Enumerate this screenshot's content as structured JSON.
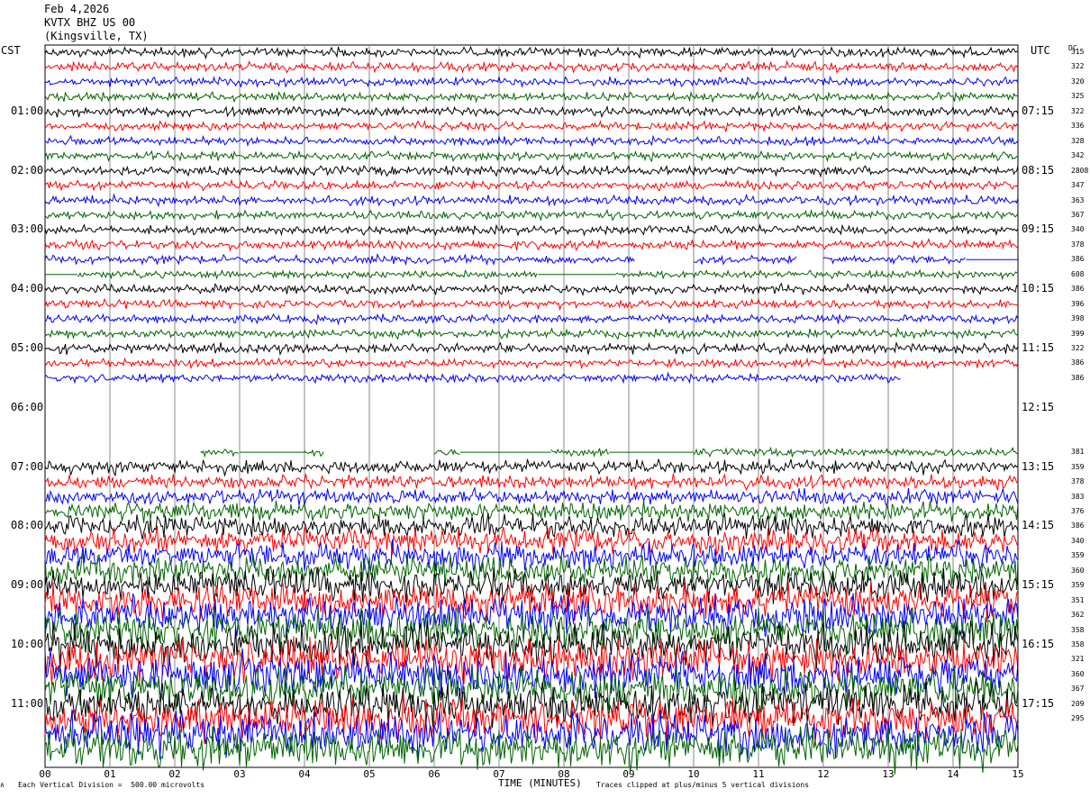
{
  "header": {
    "date": "Feb 4,2026",
    "station": "KVTX BHZ US 00",
    "location": "(Kingsville, TX)"
  },
  "left_zone": "CST",
  "right_zone": "UTC",
  "dc_label": "DC",
  "footer": {
    "vertical_division": "Each Vertical Division =  500.00 microvolts",
    "clipping_note": "Traces clipped at plus/minus 5 vertical divisions",
    "corner_glyph": "∧"
  },
  "chart_data": {
    "type": "line",
    "title": "KVTX BHZ US 00 (Kingsville, TX) Feb 4,2026",
    "xlabel": "TIME (MINUTES)",
    "ylabel": "",
    "xlim": [
      0,
      15
    ],
    "x_ticks": [
      "00",
      "01",
      "02",
      "03",
      "04",
      "05",
      "06",
      "07",
      "08",
      "09",
      "10",
      "11",
      "12",
      "13",
      "14",
      "15"
    ],
    "rows_per_hour": 4,
    "row_minutes": 15,
    "row_count": 48,
    "trace_colors": [
      "#000000",
      "#ff0000",
      "#0000ff",
      "#006400"
    ],
    "hour_labels_left": [
      "01:00",
      "02:00",
      "03:00",
      "04:00",
      "05:00",
      "06:00",
      "07:00",
      "08:00",
      "09:00",
      "10:00",
      "11:00"
    ],
    "hour_labels_right": [
      "07:15",
      "08:15",
      "09:15",
      "10:15",
      "11:15",
      "12:15",
      "13:15",
      "14:15",
      "15:15",
      "16:15",
      "17:15"
    ],
    "dc_offsets": [
      "315",
      "322",
      "320",
      "325",
      "322",
      "336",
      "328",
      "342",
      "2808",
      "347",
      "363",
      "367",
      "340",
      "378",
      "386",
      "608",
      "386",
      "396",
      "398",
      "399",
      "322",
      "386",
      "386",
      "",
      "",
      "",
      "",
      "381",
      "359",
      "378",
      "383",
      "376",
      "386",
      "340",
      "359",
      "360",
      "359",
      "351",
      "362",
      "358",
      "358",
      "321",
      "360",
      "367",
      "209",
      "295"
    ],
    "row_amplitude_divisions": [
      1.1,
      1.1,
      1.0,
      1.0,
      1.1,
      1.0,
      1.0,
      1.0,
      1.1,
      1.1,
      1.1,
      1.0,
      1.0,
      1.1,
      1.0,
      0.9,
      1.1,
      1.0,
      1.0,
      1.0,
      1.2,
      1.0,
      1.0,
      0,
      0,
      0,
      0,
      0.9,
      1.6,
      1.7,
      1.8,
      2.2,
      2.6,
      3.0,
      3.2,
      3.6,
      3.8,
      4.2,
      4.5,
      4.8,
      4.8,
      4.9,
      5.0,
      5.0,
      5.0,
      5.0,
      5.0,
      5.0
    ],
    "data_segments_minutes": [
      [
        [
          0,
          15
        ]
      ],
      [
        [
          0,
          15
        ]
      ],
      [
        [
          0,
          15
        ]
      ],
      [
        [
          0,
          15
        ]
      ],
      [
        [
          0,
          15
        ]
      ],
      [
        [
          0,
          15
        ]
      ],
      [
        [
          0,
          15
        ]
      ],
      [
        [
          0,
          15
        ]
      ],
      [
        [
          0,
          15
        ]
      ],
      [
        [
          0,
          15
        ]
      ],
      [
        [
          0,
          15
        ]
      ],
      [
        [
          0,
          15
        ]
      ],
      [
        [
          0,
          15
        ]
      ],
      [
        [
          0,
          15
        ]
      ],
      [
        [
          0,
          9.1
        ],
        [
          10.0,
          11.6
        ],
        [
          12.0,
          14.2
        ]
      ],
      [
        [
          0.5,
          7.6
        ],
        [
          8.8,
          15
        ]
      ],
      [
        [
          0,
          15
        ]
      ],
      [
        [
          0,
          15
        ]
      ],
      [
        [
          0,
          15
        ]
      ],
      [
        [
          0,
          15
        ]
      ],
      [
        [
          0,
          15
        ]
      ],
      [
        [
          0,
          15
        ]
      ],
      [
        [
          0,
          13.2
        ]
      ],
      [],
      [],
      [],
      [],
      [
        [
          2.4,
          3.0
        ],
        [
          4.0,
          4.3
        ],
        [
          6.0,
          6.4
        ],
        [
          7.8,
          8.7
        ],
        [
          10.0,
          15
        ]
      ],
      [
        [
          0,
          15
        ]
      ],
      [
        [
          0,
          15
        ]
      ],
      [
        [
          0,
          15
        ]
      ],
      [
        [
          0,
          15
        ]
      ],
      [
        [
          0,
          15
        ]
      ],
      [
        [
          0,
          15
        ]
      ],
      [
        [
          0,
          15
        ]
      ],
      [
        [
          0,
          15
        ]
      ],
      [
        [
          0,
          15
        ]
      ],
      [
        [
          0,
          15
        ]
      ],
      [
        [
          0,
          15
        ]
      ],
      [
        [
          0,
          15
        ]
      ],
      [
        [
          0,
          15
        ]
      ],
      [
        [
          0,
          15
        ]
      ],
      [
        [
          0,
          15
        ]
      ],
      [
        [
          0,
          15
        ]
      ],
      [
        [
          0,
          15
        ]
      ],
      [
        [
          0,
          15
        ]
      ],
      [
        [
          0,
          15
        ]
      ],
      [
        [
          0,
          15
        ]
      ]
    ],
    "flat_segments_minutes": {
      "14": [
        [
          14.2,
          15
        ]
      ],
      "15": [
        [
          0,
          0.5
        ],
        [
          7.6,
          8.8
        ]
      ],
      "27": [
        [
          3.0,
          4.0
        ],
        [
          6.4,
          7.8
        ],
        [
          8.7,
          10.0
        ]
      ]
    },
    "grid": true
  }
}
